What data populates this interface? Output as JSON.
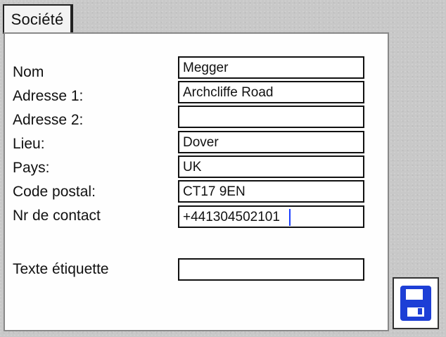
{
  "tab": {
    "label": "Société"
  },
  "form": {
    "rows": [
      {
        "label": "Nom",
        "value": "Megger"
      },
      {
        "label": "Adresse 1:",
        "value": "Archcliffe Road"
      },
      {
        "label": "Adresse 2:",
        "value": ""
      },
      {
        "label": "Lieu:",
        "value": "Dover"
      },
      {
        "label": "Pays:",
        "value": "UK"
      },
      {
        "label": "Code postal:",
        "value": "CT17 9EN"
      },
      {
        "label": "Nr de contact",
        "value": "+441304502101"
      },
      {
        "label": "Texte étiquette",
        "value": ""
      }
    ]
  },
  "actions": {
    "save_icon": "save-icon",
    "save_color": "#1d3fd6"
  }
}
